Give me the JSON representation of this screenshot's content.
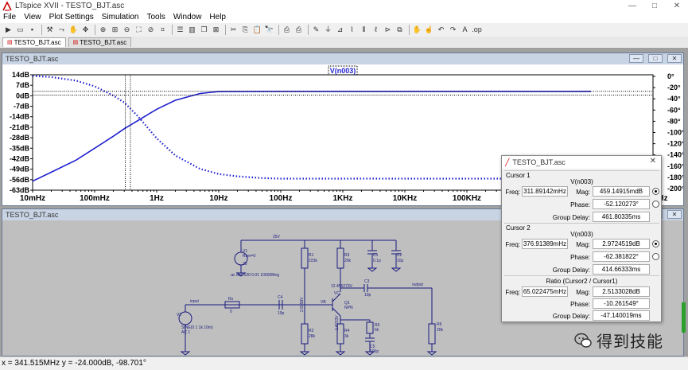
{
  "app": {
    "title": "LTspice XVII - TESTO_BJT.asc"
  },
  "window_controls": {
    "minimize": "—",
    "maximize": "□",
    "close": "✕"
  },
  "menu": [
    "File",
    "View",
    "Plot Settings",
    "Simulation",
    "Tools",
    "Window",
    "Help"
  ],
  "toolbar_icons": [
    "run-icon",
    "open-icon",
    "save-icon",
    "control-panel-icon",
    "run-stop-icon",
    "halt-icon",
    "pan-icon",
    "zoom-in-icon",
    "zoom-fit-icon",
    "zoom-out-icon",
    "zoom-full-icon",
    "cancel-icon",
    "autorange-icon",
    "tile-h-icon",
    "tile-v-icon",
    "cascade-icon",
    "close-window-icon",
    "cut-icon",
    "copy-icon",
    "paste-icon",
    "find-icon",
    "print-setup-icon",
    "print-icon",
    "wire-icon",
    "ground-icon",
    "label-icon",
    "resistor-icon",
    "capacitor-icon",
    "inductor-icon",
    "diode-icon",
    "component-icon",
    "move-icon",
    "drag-icon",
    "undo-icon",
    "redo-icon",
    "text-icon",
    "spice-directive-icon"
  ],
  "doc_tabs": [
    "TESTO_BJT.asc",
    "TESTO_BJT.asc"
  ],
  "plot_window": {
    "title": "TESTO_BJT.asc",
    "trace_label": "V(n003)"
  },
  "chart_data": {
    "type": "line",
    "title": "",
    "trace": "V(n003)",
    "xscale": "log",
    "x_ticks": [
      "10mHz",
      "100mHz",
      "1Hz",
      "10Hz",
      "100Hz",
      "1KHz",
      "10KHz",
      "100KHz",
      "1MHz",
      "10MHz",
      "100MHz"
    ],
    "y_left_ticks": [
      "14dB",
      "7dB",
      "0dB",
      "-7dB",
      "-14dB",
      "-21dB",
      "-28dB",
      "-35dB",
      "-42dB",
      "-49dB",
      "-56dB",
      "-63dB"
    ],
    "y_right_ticks": [
      "0°",
      "-20°",
      "-40°",
      "-60°",
      "-80°",
      "-100°",
      "-120°",
      "-140°",
      "-160°",
      "-180°",
      "-200°"
    ],
    "y_left_range": [
      -63,
      14
    ],
    "y_right_range": [
      -200,
      0
    ],
    "series": [
      {
        "name": "V(n003)",
        "kind": "magnitude",
        "style": "solid",
        "x_hz": [
          0.01,
          0.02,
          0.05,
          0.1,
          0.2,
          0.3,
          0.5,
          1,
          2,
          5,
          10,
          100,
          1000,
          10000,
          100000,
          1000000,
          10000000
        ],
        "y_db": [
          -57,
          -51,
          -43,
          -35,
          -27,
          -22,
          -16.5,
          -9,
          -3,
          1.5,
          2.8,
          2.97,
          2.97,
          2.97,
          2.97,
          2.97,
          2.97
        ]
      },
      {
        "name": "V(n003)",
        "kind": "phase",
        "style": "dotted",
        "x_hz": [
          0.01,
          0.02,
          0.05,
          0.1,
          0.2,
          0.3,
          0.5,
          1,
          2,
          5,
          10,
          20,
          50,
          100,
          1000,
          10000,
          100000,
          1000000,
          10000000
        ],
        "y_deg": [
          -2,
          -4,
          -10,
          -20,
          -36,
          -48,
          -72,
          -110,
          -140,
          -163,
          -172,
          -176,
          -179,
          -180,
          -180,
          -180,
          -180,
          -180,
          -180
        ]
      }
    ],
    "cursor_freqs_hz": [
      0.31189142,
      0.37691389
    ]
  },
  "schematic_window": {
    "title": "TESTO_BJT.asc",
    "labels": {
      "supply_net": "25V",
      "v1": "V1",
      "v1_val": "25",
      "v1_rser": "Rser=0",
      "directive": ".ac dec 100 0.01 10000Meg",
      "r1": "R1",
      "r1_val": "223k",
      "r2": "R2",
      "r2_val": "28k",
      "r3": "R3",
      "r3_val": "20k",
      "r4": "R4",
      "r4_val": "3k",
      "r5": "R5",
      "r5_val": "6k",
      "r6": "R6",
      "r6_val": "20k",
      "rs": "Rs",
      "rs_val": "0",
      "c1": "C1",
      "c1_val": "0.1p",
      "c2": "C2",
      "c2_val": "10p",
      "c3": "C3",
      "c3_val": "10p",
      "c4": "C4",
      "c4_val": "10p",
      "c5": "C5",
      "c5_val": "100p",
      "q1": "Q1",
      "q1_type": "NPN",
      "v2": "V2",
      "v2_val": "SINE(0 1 1k 10m)",
      "v2_ac": "AC 1",
      "input": "input",
      "output": "output",
      "vb": "VB",
      "vc": "VC",
      "vc_val": "12.455273V",
      "vb_val": "2.6059V",
      "ve_val": "1.8233V"
    }
  },
  "cursor_dialog": {
    "title": "TESTO_BJT.asc",
    "cursor1": {
      "label": "Cursor 1",
      "signal": "V(n003)",
      "freq_label": "Freq:",
      "freq": "311.89142mHz",
      "mag_label": "Mag:",
      "mag": "459.14915mdB",
      "phase_label": "Phase:",
      "phase": "-52.120273°",
      "gd_label": "Group Delay:",
      "gd": "461.80335ms"
    },
    "cursor2": {
      "label": "Cursor 2",
      "signal": "V(n003)",
      "freq_label": "Freq:",
      "freq": "376.91389mHz",
      "mag_label": "Mag:",
      "mag": "2.9724519dB",
      "phase_label": "Phase:",
      "phase": "-62.381822°",
      "gd_label": "Group Delay:",
      "gd": "414.66333ms"
    },
    "ratio": {
      "label": "Ratio (Cursor2 / Cursor1)",
      "freq_label": "Freq:",
      "freq": "65.022475mHz",
      "mag_label": "Mag:",
      "mag": "2.5133028dB",
      "phase_label": "Phase:",
      "phase": "-10.261549°",
      "gd_label": "Group Delay:",
      "gd": "-47.140019ms"
    }
  },
  "status": {
    "text": "x = 341.515MHz    y = -24.000dB, -98.701°"
  },
  "watermark": {
    "text": "得到技能"
  },
  "colors": {
    "trace": "#1f1fcf",
    "mdi_bg": "#a0a0a0",
    "schematic_bg": "#bfbfbf",
    "wire": "#1a1a80"
  }
}
